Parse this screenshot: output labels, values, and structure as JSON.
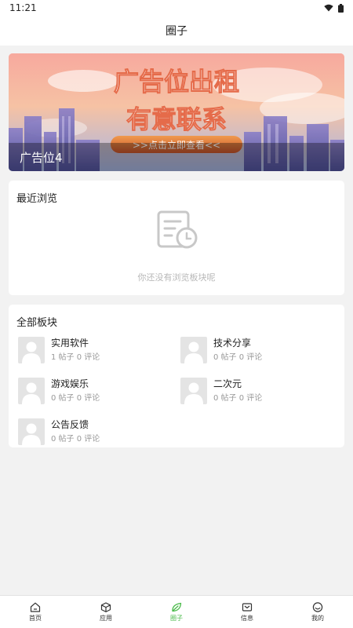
{
  "status_bar": {
    "time": "11:21",
    "wifi_icon": "wifi-icon",
    "battery_icon": "battery-icon"
  },
  "header": {
    "title": "圈子"
  },
  "banner": {
    "headline": "广告位出租",
    "subline": "有意联系",
    "cta": ">>点击立即查看<<",
    "caption": "广告位4"
  },
  "recent": {
    "title": "最近浏览",
    "empty_icon": "history-document-icon",
    "empty_text": "你还没有浏览板块呢"
  },
  "boards": {
    "title": "全部板块",
    "items": [
      {
        "name": "实用软件",
        "stats": "1 帖子 0 评论"
      },
      {
        "name": "技术分享",
        "stats": "0 帖子 0 评论"
      },
      {
        "name": "游戏娱乐",
        "stats": "0 帖子 0 评论"
      },
      {
        "name": "二次元",
        "stats": "0 帖子 0 评论"
      },
      {
        "name": "公告反馈",
        "stats": "0 帖子 0 评论"
      }
    ]
  },
  "tabs": [
    {
      "label": "首页",
      "icon": "home-icon"
    },
    {
      "label": "应用",
      "icon": "cube-icon"
    },
    {
      "label": "圈子",
      "icon": "leaf-icon",
      "active": true
    },
    {
      "label": "信息",
      "icon": "mail-icon"
    },
    {
      "label": "我的",
      "icon": "smile-icon"
    }
  ],
  "colors": {
    "accent": "#4cbb4c",
    "background": "#f2f2f2",
    "muted": "#999999"
  }
}
